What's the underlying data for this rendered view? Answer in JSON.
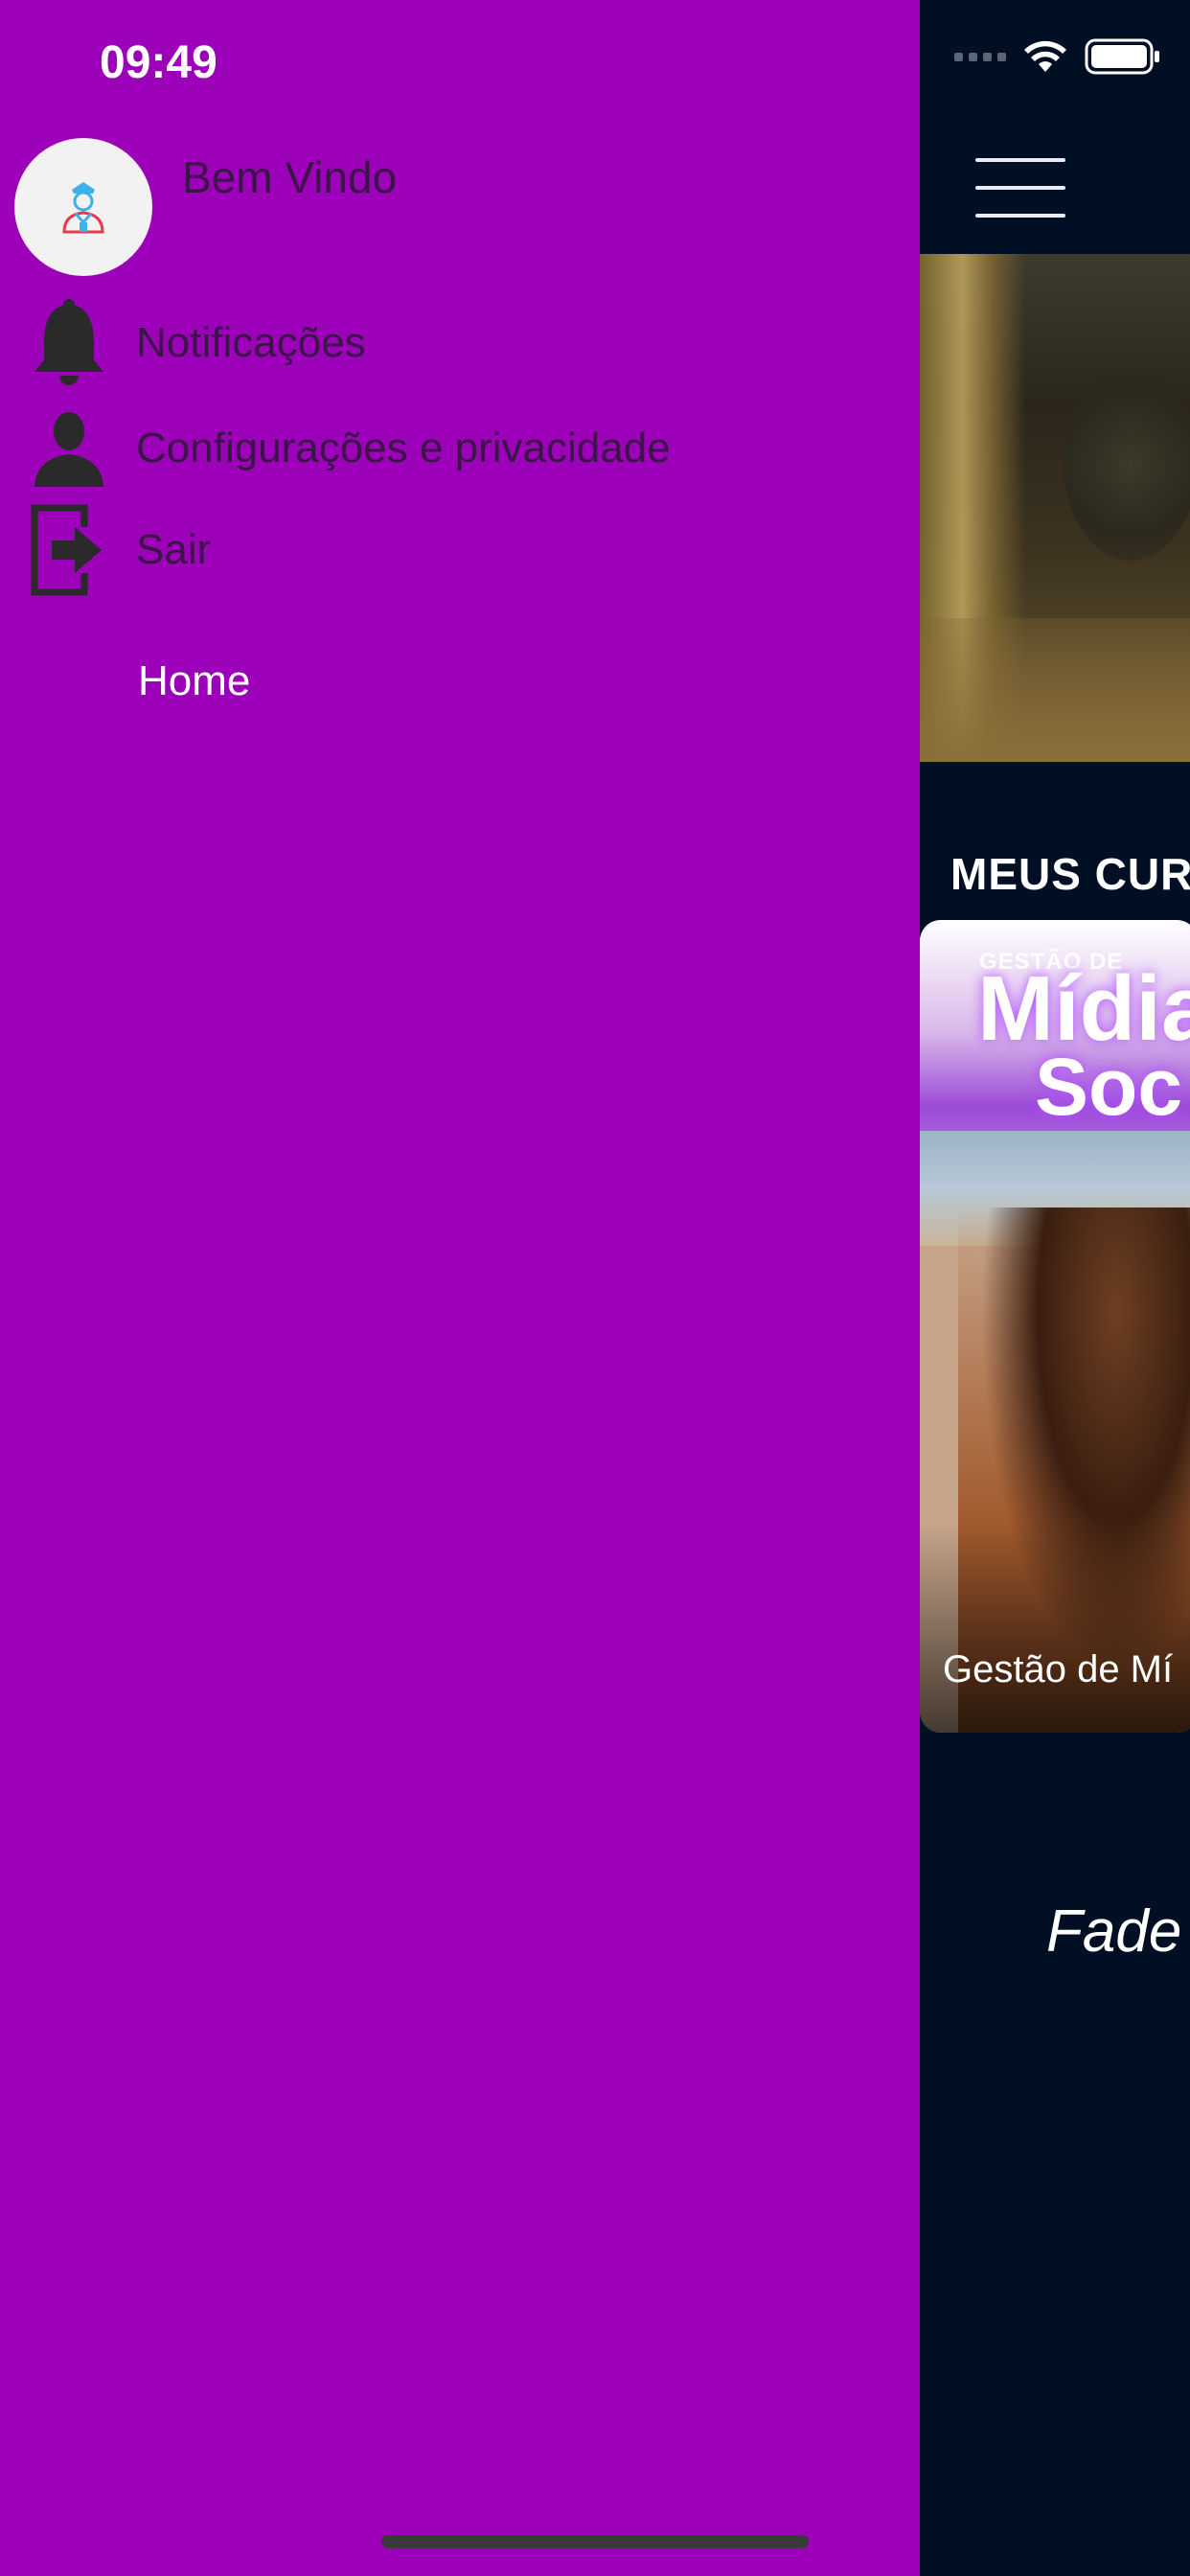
{
  "status_bar": {
    "time": "09:49"
  },
  "drawer": {
    "welcome": "Bem Vindo",
    "items": [
      {
        "label": "Notificações",
        "icon": "bell-icon"
      },
      {
        "label": "Configurações e privacidade",
        "icon": "person-icon"
      },
      {
        "label": "Sair",
        "icon": "logout-icon"
      }
    ],
    "home": "Home"
  },
  "main": {
    "section_title": "MEUS CUR",
    "course_card": {
      "kicker": "GESTÃO DE",
      "title_line1": "Mídia",
      "title_line2": "Soc",
      "caption": "Gestão de Mí"
    },
    "brand": "Fade"
  },
  "colors": {
    "drawer_bg": "#9c00b8",
    "app_bg": "#000f24",
    "drawer_text": "#3b1548"
  }
}
